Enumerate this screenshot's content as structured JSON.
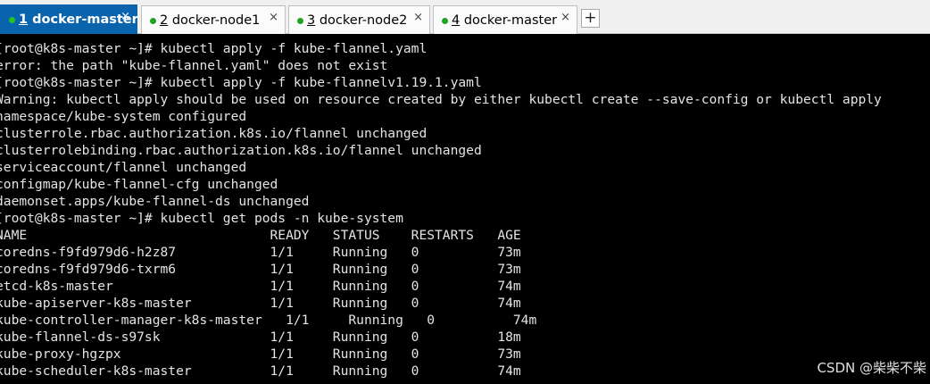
{
  "tabs": [
    {
      "num": "1",
      "label": " docker-master",
      "close": "×"
    },
    {
      "num": "2",
      "label": " docker-node1",
      "close": "×"
    },
    {
      "num": "3",
      "label": " docker-node2",
      "close": "×"
    },
    {
      "num": "4",
      "label": " docker-master",
      "close": "×"
    }
  ],
  "new_tab_label": "+",
  "terminal": {
    "lines": [
      "[root@k8s-master ~]# kubectl apply -f kube-flannel.yaml",
      "error: the path \"kube-flannel.yaml\" does not exist",
      "[root@k8s-master ~]# kubectl apply -f kube-flannelv1.19.1.yaml",
      "Warning: kubectl apply should be used on resource created by either kubectl create --save-config or kubectl apply",
      "namespace/kube-system configured",
      "clusterrole.rbac.authorization.k8s.io/flannel unchanged",
      "clusterrolebinding.rbac.authorization.k8s.io/flannel unchanged",
      "serviceaccount/flannel unchanged",
      "configmap/kube-flannel-cfg unchanged",
      "daemonset.apps/kube-flannel-ds unchanged",
      "[root@k8s-master ~]# kubectl get pods -n kube-system",
      "NAME                               READY   STATUS    RESTARTS   AGE",
      "coredns-f9fd979d6-h2z87            1/1     Running   0          73m",
      "coredns-f9fd979d6-txrm6            1/1     Running   0          73m",
      "etcd-k8s-master                    1/1     Running   0          74m",
      "kube-apiserver-k8s-master          1/1     Running   0          74m",
      "kube-controller-manager-k8s-master   1/1     Running   0          74m",
      "kube-flannel-ds-s97sk              1/1     Running   0          18m",
      "kube-proxy-hgzpx                   1/1     Running   0          73m",
      "kube-scheduler-k8s-master          1/1     Running   0          74m"
    ]
  },
  "watermark": "CSDN @柴柴不柴",
  "colors": {
    "active_tab": "#0a64ad",
    "status_dot": "#1fa31f",
    "terminal_bg": "#000000",
    "terminal_fg": "#e4e4e4"
  }
}
